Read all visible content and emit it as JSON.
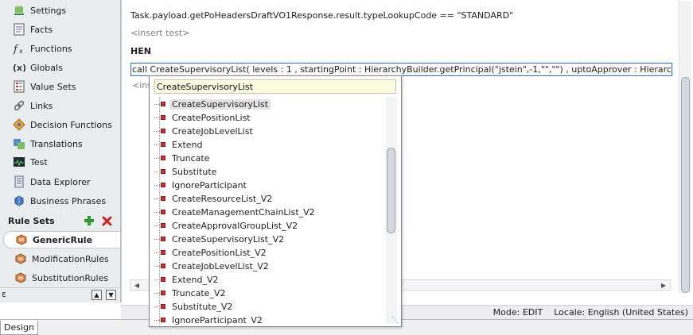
{
  "nav": {
    "items": [
      {
        "label": "Settings",
        "icon": "settings-icon"
      },
      {
        "label": "Facts",
        "icon": "facts-icon"
      },
      {
        "label": "Functions",
        "icon": "functions-icon"
      },
      {
        "label": "Globals",
        "icon": "globals-icon"
      },
      {
        "label": "Value Sets",
        "icon": "value-sets-icon"
      },
      {
        "label": "Links",
        "icon": "links-icon"
      },
      {
        "label": "Decision Functions",
        "icon": "decision-functions-icon"
      },
      {
        "label": "Translations",
        "icon": "translations-icon"
      },
      {
        "label": "Test",
        "icon": "test-icon"
      },
      {
        "label": "Data Explorer",
        "icon": "data-explorer-icon"
      },
      {
        "label": "Business Phrases",
        "icon": "business-phrases-icon"
      }
    ],
    "rule_sets": {
      "header": "Rule Sets",
      "items": [
        {
          "label": "GenericRule",
          "active": true
        },
        {
          "label": "ModificationRules",
          "active": false
        },
        {
          "label": "SubstitutionRules",
          "active": false
        }
      ]
    }
  },
  "editor": {
    "condition_line": "Task.payload.getPoHeadersDraftVO1Response.result.typeLookupCode  ==  \"STANDARD\"",
    "insert_test": "<insert test>",
    "then_label": "HEN",
    "action_line": "call  CreateSupervisoryList( levels : 1 , startingPoint : HierarchyBuilder.getPrincipal(\"jstein\",-1,\"\",\"\") , uptoApprover : HierarchyBu",
    "insert_action_partial": "<ins"
  },
  "popup": {
    "input_value": "CreateSupervisoryList",
    "items": [
      "CreateSupervisoryList",
      "CreatePositionList",
      "CreateJobLevelList",
      "Extend",
      "Truncate",
      "Substitute",
      "IgnoreParticipant",
      "CreateResourceList_V2",
      "CreateManagementChainList_V2",
      "CreateApprovalGroupList_V2",
      "CreateSupervisoryList_V2",
      "CreatePositionList_V2",
      "CreateJobLevelList_V2",
      "Extend_V2",
      "Truncate_V2",
      "Substitute_V2",
      "IgnoreParticipant_V2"
    ],
    "selected_index": 0
  },
  "status": {
    "mode": "Mode: EDIT",
    "locale": "Locale: English (United States)"
  },
  "tabs": {
    "design": "Design"
  },
  "colors": {
    "nav_bg": "#eaedf0",
    "popup_input_bg": "#fcfbe2",
    "focus_border": "#2a6bd7",
    "item_marker": "#d02c2c",
    "add_green": "#2e9b2e",
    "delete_red": "#d42020"
  }
}
